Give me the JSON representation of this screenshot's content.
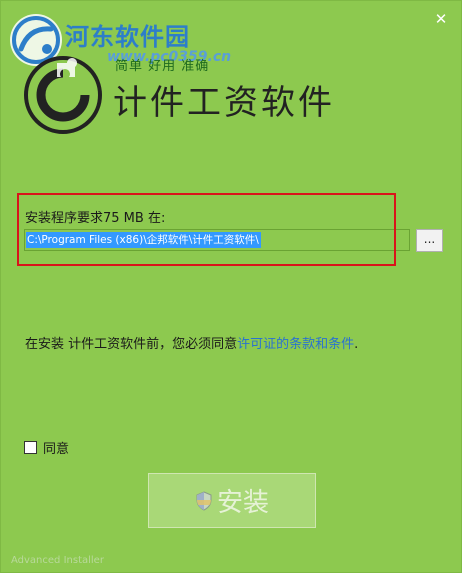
{
  "watermark": {
    "site_name": "河东软件园",
    "url": "www.pc0359.cn"
  },
  "window": {
    "close_label": "✕"
  },
  "app": {
    "tagline": "简单 好用 准确",
    "title": "计件工资软件"
  },
  "install_path": {
    "label": "安装程序要求75 MB 在:",
    "value": "C:\\Program Files (x86)\\企邦软件\\计件工资软件\\",
    "browse_label": "..."
  },
  "license": {
    "prefix": "在安装 计件工资软件前，您必须同意",
    "link": "许可证的条款和条件",
    "suffix": "."
  },
  "agree": {
    "label": "同意",
    "checked": false
  },
  "install_button": {
    "label": "安装"
  },
  "footer": {
    "brand": "Advanced Installer"
  },
  "colors": {
    "background": "#8dc94f",
    "highlight": "#d9141b",
    "selection": "#3399ff",
    "link": "#2a72d0"
  }
}
